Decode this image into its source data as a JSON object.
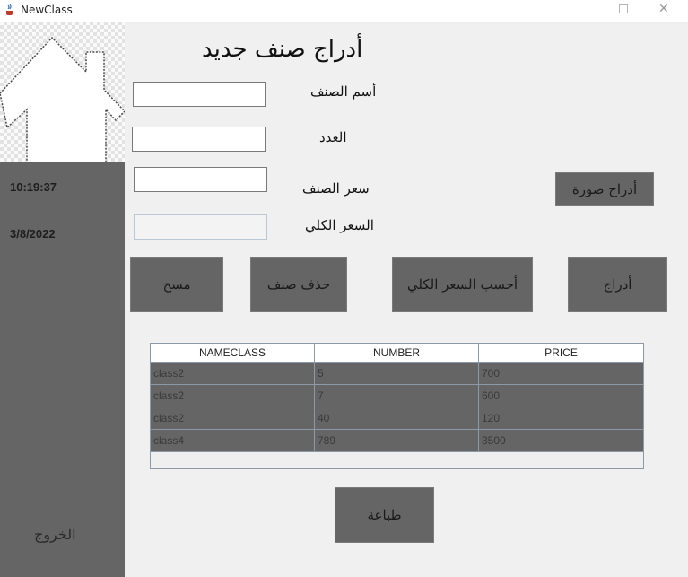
{
  "window": {
    "title": "NewClass",
    "close_glyph": "✕"
  },
  "sidebar": {
    "time": "10:19:37",
    "date": "3/8/2022",
    "exit_label": "الخروج"
  },
  "form": {
    "title": "أدراج صنف جديد",
    "name_label": "أسم الصنف",
    "name_value": "",
    "count_label": "العدد",
    "count_value": "",
    "price_label": "سعر الصنف",
    "price_value": "",
    "total_label": "السعر الكلي",
    "total_value": ""
  },
  "buttons": {
    "insert_image": "أدراج صورة",
    "clear": "مسح",
    "delete": "حذف صنف",
    "calculate": "أحسب السعر الكلي",
    "insert": "أدراج",
    "print": "طباعة"
  },
  "table": {
    "columns": [
      "NAMECLASS",
      "NUMBER",
      "PRICE"
    ],
    "rows": [
      [
        "class2",
        "5",
        "700"
      ],
      [
        "class2",
        "7",
        "600"
      ],
      [
        "class2",
        "40",
        "120"
      ],
      [
        "class4",
        "789",
        "3500"
      ]
    ]
  },
  "colors": {
    "panel": "#656565",
    "background": "#f0f0f0"
  }
}
